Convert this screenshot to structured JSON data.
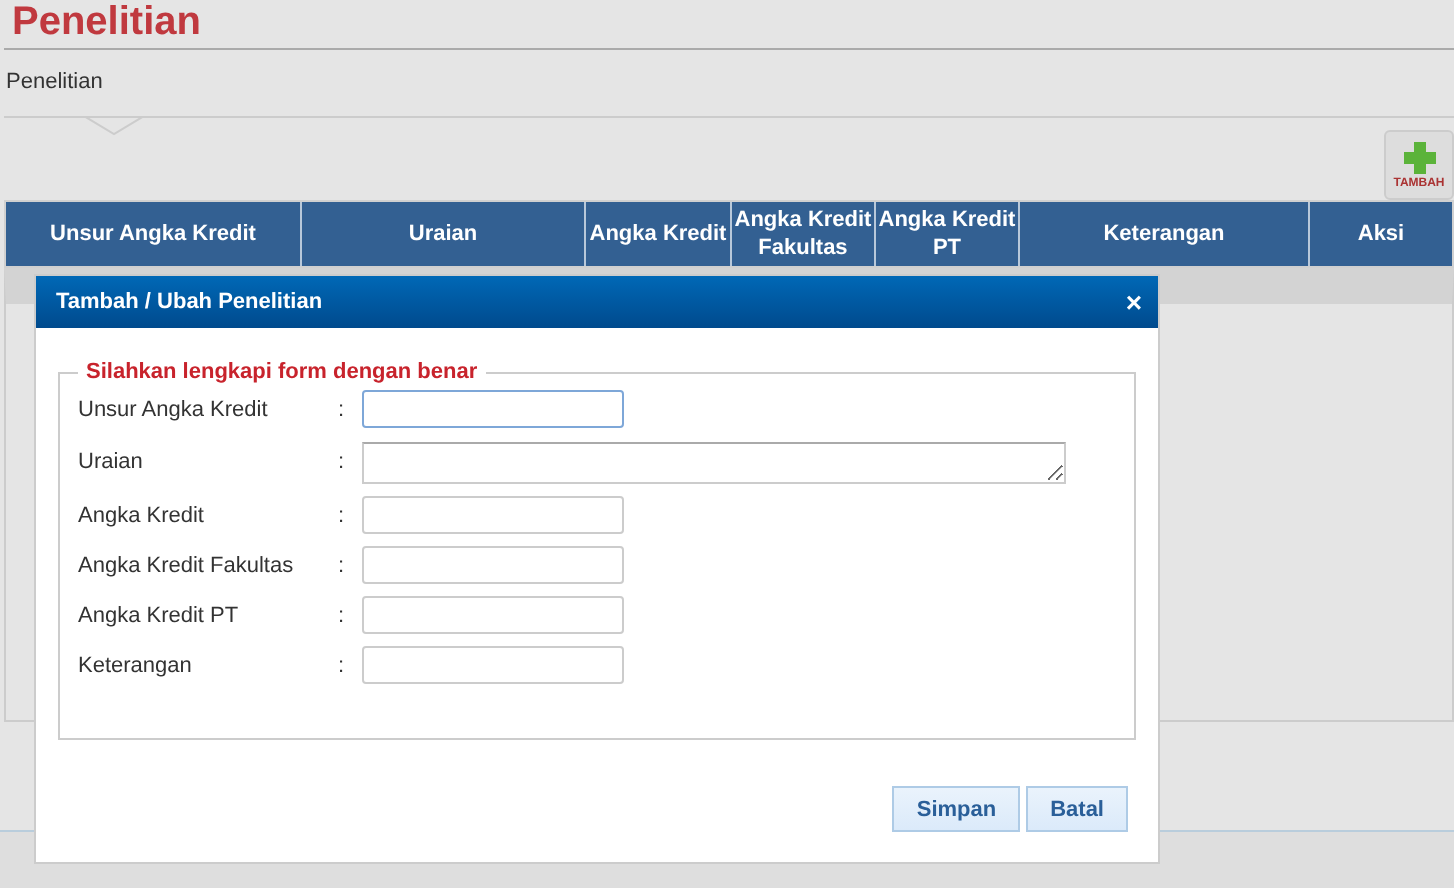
{
  "page_title": "Penelitian",
  "breadcrumb": "Penelitian",
  "add_button": {
    "label": "TAMBAH"
  },
  "table": {
    "columns": [
      "Unsur Angka Kredit",
      "Uraian",
      "Angka Kredit",
      "Angka Kredit Fakultas",
      "Angka Kredit PT",
      "Keterangan",
      "Aksi"
    ]
  },
  "dialog": {
    "title": "Tambah / Ubah Penelitian",
    "close": "×",
    "legend": "Silahkan lengkapi form dengan benar",
    "fields": [
      {
        "label": "Unsur Angka Kredit",
        "kind": "input",
        "focused": true
      },
      {
        "label": "Uraian",
        "kind": "textarea",
        "focused": false
      },
      {
        "label": "Angka Kredit",
        "kind": "input",
        "focused": false
      },
      {
        "label": "Angka Kredit Fakultas",
        "kind": "input",
        "focused": false
      },
      {
        "label": "Angka Kredit PT",
        "kind": "input",
        "focused": false
      },
      {
        "label": "Keterangan",
        "kind": "input",
        "focused": false
      }
    ],
    "separator": ":",
    "buttons": [
      "Simpan",
      "Batal"
    ]
  }
}
